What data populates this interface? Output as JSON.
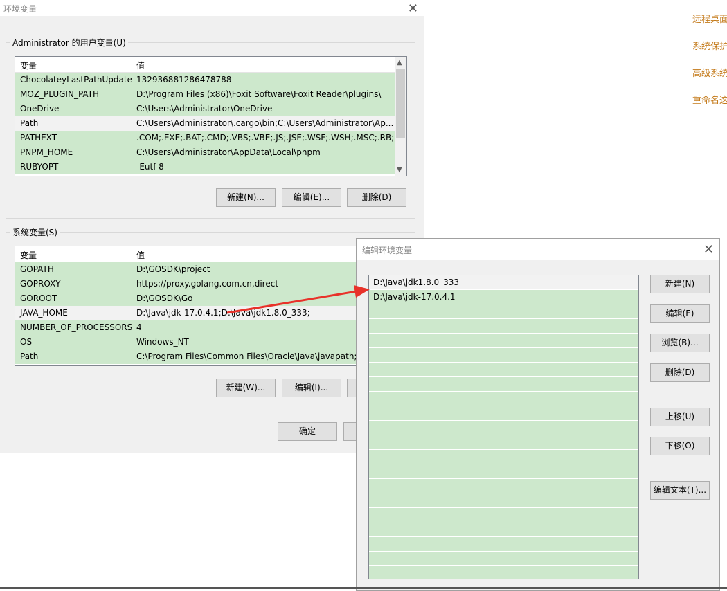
{
  "background_links": [
    "远程桌面",
    "系统保护",
    "高级系统",
    "重命名这"
  ],
  "env_dialog": {
    "title": "环境变量",
    "user_group_label": "Administrator 的用户变量(U)",
    "system_group_label": "系统变量(S)",
    "col_var": "变量",
    "col_val": "值",
    "user_vars": [
      {
        "name": "ChocolateyLastPathUpdate",
        "value": "132936881286478788"
      },
      {
        "name": "MOZ_PLUGIN_PATH",
        "value": "D:\\Program Files (x86)\\Foxit Software\\Foxit Reader\\plugins\\"
      },
      {
        "name": "OneDrive",
        "value": "C:\\Users\\Administrator\\OneDrive"
      },
      {
        "name": "Path",
        "value": "C:\\Users\\Administrator\\.cargo\\bin;C:\\Users\\Administrator\\Ap..."
      },
      {
        "name": "PATHEXT",
        "value": ".COM;.EXE;.BAT;.CMD;.VBS;.VBE;.JS;.JSE;.WSF;.WSH;.MSC;.RB;...."
      },
      {
        "name": "PNPM_HOME",
        "value": "C:\\Users\\Administrator\\AppData\\Local\\pnpm"
      },
      {
        "name": "RUBYOPT",
        "value": "-Eutf-8"
      }
    ],
    "user_buttons": {
      "new": "新建(N)...",
      "edit": "编辑(E)...",
      "delete": "删除(D)"
    },
    "system_vars": [
      {
        "name": "GOPATH",
        "value": "D:\\GOSDK\\project"
      },
      {
        "name": "GOPROXY",
        "value": "https://proxy.golang.com.cn,direct"
      },
      {
        "name": "GOROOT",
        "value": "D:\\GOSDK\\Go"
      },
      {
        "name": "JAVA_HOME",
        "value": "D:\\Java\\jdk-17.0.4.1;D:\\Java\\jdk1.8.0_333;"
      },
      {
        "name": "NUMBER_OF_PROCESSORS",
        "value": "4"
      },
      {
        "name": "OS",
        "value": "Windows_NT"
      },
      {
        "name": "Path",
        "value": "C:\\Program Files\\Common Files\\Oracle\\Java\\javapath;C"
      }
    ],
    "system_buttons": {
      "new": "新建(W)...",
      "edit": "编辑(I)..."
    },
    "ok_button": "确定"
  },
  "edit_dialog": {
    "title": "编辑环境变量",
    "entries": [
      "D:\\Java\\jdk1.8.0_333",
      "D:\\Java\\jdk-17.0.4.1"
    ],
    "buttons": {
      "new": "新建(N)",
      "edit": "编辑(E)",
      "browse": "浏览(B)...",
      "delete": "删除(D)",
      "move_up": "上移(U)",
      "move_down": "下移(O)",
      "edit_text": "编辑文本(T)..."
    }
  },
  "colors": {
    "row_green": "#cde8cc",
    "arrow_red": "#e8322a",
    "link_orange": "#c47a1a"
  }
}
